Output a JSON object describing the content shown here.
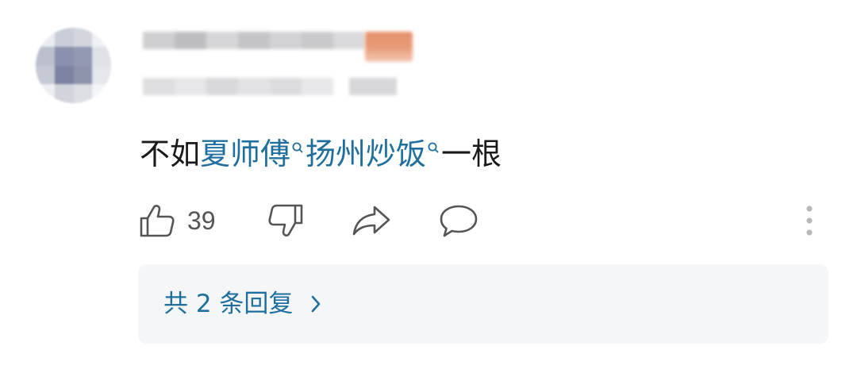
{
  "comment": {
    "segments": [
      {
        "type": "text",
        "text": "不如"
      },
      {
        "type": "keyword",
        "text": "夏师傅"
      },
      {
        "type": "keyword",
        "text": "扬州炒饭"
      },
      {
        "type": "text",
        "text": "一根"
      }
    ]
  },
  "actions": {
    "like_count": "39"
  },
  "replies": {
    "label": "共 2 条回复"
  },
  "colors": {
    "keyword": "#1f6f9e",
    "text": "#1a1a1a",
    "icon": "#555555",
    "reply_bg": "#f4f6f8",
    "badge": "#e8967a"
  },
  "icons": [
    "thumbs-up-icon",
    "thumbs-down-icon",
    "share-icon",
    "comment-icon",
    "more-vertical-icon",
    "chevron-right-icon",
    "search-icon"
  ]
}
